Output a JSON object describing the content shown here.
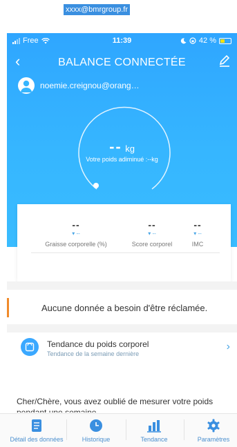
{
  "banner_email": "xxxx@bmrgroup.fr",
  "status": {
    "carrier": "Free",
    "time": "11:39",
    "battery": "42 %",
    "icons": [
      "signal-icon",
      "wifi-icon",
      "moon-icon",
      "rotation-lock-icon",
      "battery-icon"
    ]
  },
  "nav": {
    "title": "BALANCE CONNECTÉE",
    "back_icon": "chevron-left-icon",
    "edit_icon": "pencil-icon"
  },
  "user": {
    "email": "noemie.creignou@orang…"
  },
  "weight": {
    "value": "--",
    "unit": "kg",
    "subtitle": "Votre poids adiminué :--kg"
  },
  "stats": [
    {
      "value": "--",
      "trend": "▾ --",
      "label": "Graisse corporelle (%)"
    },
    {
      "value": "--",
      "trend": "▾ --",
      "label": "Score corporel"
    },
    {
      "value": "--",
      "trend": "▾ --",
      "label": "IMC"
    }
  ],
  "notice": {
    "text": "Aucune donnée a besoin d'être réclamée."
  },
  "trend_card": {
    "title": "Tendance du poids corporel",
    "subtitle": "Tendance de la semaine dernière",
    "chevron": "›"
  },
  "reminder": {
    "text": "Cher/Chère, vous avez oublié de mesurer votre poids pendant une semaine"
  },
  "tabs": [
    {
      "label": "Détail des données",
      "icon": "document-icon"
    },
    {
      "label": "Historique",
      "icon": "clock-icon"
    },
    {
      "label": "Tendance",
      "icon": "bar-chart-icon"
    },
    {
      "label": "Paramètres",
      "icon": "gear-icon"
    }
  ],
  "colors": {
    "primary": "#36b6ff",
    "accent_orange": "#f08a2a",
    "tab_blue": "#4a8fcf"
  }
}
